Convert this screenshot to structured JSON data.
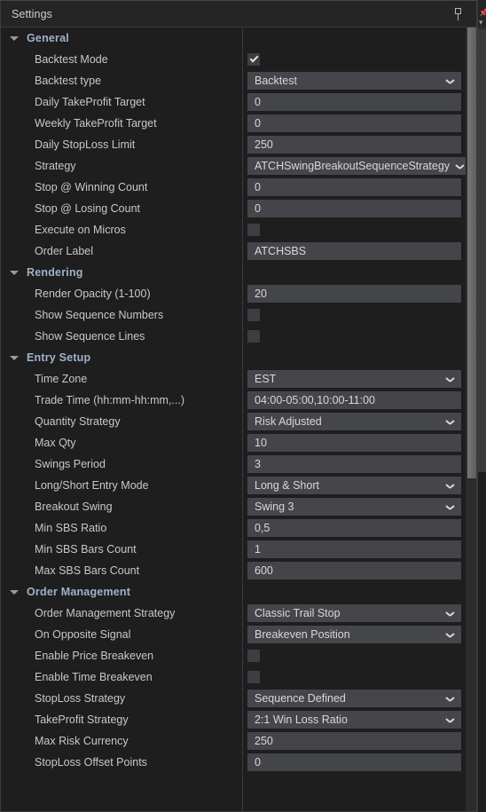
{
  "window": {
    "title": "Settings",
    "pin_icon": "pin-icon"
  },
  "neighbor": {
    "pin_icon": "pin-icon",
    "collapse_icon": "chevron-down-icon"
  },
  "sections": [
    {
      "label": "General",
      "rows": [
        {
          "label": "Backtest Mode",
          "type": "checkbox",
          "value": "checked"
        },
        {
          "label": "Backtest type",
          "type": "select",
          "value": "Backtest"
        },
        {
          "label": "Daily TakeProfit Target",
          "type": "text",
          "value": "0"
        },
        {
          "label": "Weekly TakeProfit Target",
          "type": "text",
          "value": "0"
        },
        {
          "label": "Daily StopLoss Limit",
          "type": "text",
          "value": "250"
        },
        {
          "label": "Strategy",
          "type": "select",
          "value": "ATCHSwingBreakoutSequenceStrategy"
        },
        {
          "label": "Stop @ Winning Count",
          "type": "text",
          "value": "0"
        },
        {
          "label": "Stop @ Losing Count",
          "type": "text",
          "value": "0"
        },
        {
          "label": "Execute on Micros",
          "type": "checkbox",
          "value": "unchecked"
        },
        {
          "label": "Order Label",
          "type": "text",
          "value": "ATCHSBS"
        }
      ]
    },
    {
      "label": "Rendering",
      "rows": [
        {
          "label": "Render Opacity (1-100)",
          "type": "text",
          "value": "20"
        },
        {
          "label": "Show Sequence Numbers",
          "type": "checkbox",
          "value": "unchecked"
        },
        {
          "label": "Show Sequence Lines",
          "type": "checkbox",
          "value": "unchecked"
        }
      ]
    },
    {
      "label": "Entry Setup",
      "rows": [
        {
          "label": "Time Zone",
          "type": "select",
          "value": "EST"
        },
        {
          "label": "Trade Time (hh:mm-hh:mm,...)",
          "type": "text",
          "value": "04:00-05:00,10:00-11:00"
        },
        {
          "label": "Quantity Strategy",
          "type": "select",
          "value": "Risk Adjusted"
        },
        {
          "label": "Max Qty",
          "type": "text",
          "value": "10"
        },
        {
          "label": "Swings Period",
          "type": "text",
          "value": "3"
        },
        {
          "label": "Long/Short Entry Mode",
          "type": "select",
          "value": "Long & Short"
        },
        {
          "label": "Breakout Swing",
          "type": "select",
          "value": "Swing 3"
        },
        {
          "label": "Min SBS Ratio",
          "type": "text",
          "value": "0,5"
        },
        {
          "label": "Min SBS Bars Count",
          "type": "text",
          "value": "1"
        },
        {
          "label": "Max SBS Bars Count",
          "type": "text",
          "value": "600"
        }
      ]
    },
    {
      "label": "Order Management",
      "rows": [
        {
          "label": "Order Management Strategy",
          "type": "select",
          "value": "Classic Trail Stop"
        },
        {
          "label": "On Opposite Signal",
          "type": "select",
          "value": "Breakeven Position"
        },
        {
          "label": "Enable Price Breakeven",
          "type": "checkbox",
          "value": "unchecked"
        },
        {
          "label": "Enable Time Breakeven",
          "type": "checkbox",
          "value": "unchecked"
        },
        {
          "label": "StopLoss Strategy",
          "type": "select",
          "value": "Sequence Defined"
        },
        {
          "label": "TakeProfit Strategy",
          "type": "select",
          "value": "2:1 Win Loss Ratio"
        },
        {
          "label": "Max Risk Currency",
          "type": "text",
          "value": "250"
        },
        {
          "label": "StopLoss Offset Points",
          "type": "text",
          "value": "0"
        }
      ]
    }
  ],
  "scrollbar": {
    "thumb_top": 0,
    "thumb_height": 508
  },
  "colors": {
    "panel_bg": "#1e1e1e",
    "titlebar_bg": "#252525",
    "field_bg": "#44454a",
    "section_text": "#9fb2c8",
    "label_text": "#c8c8c8",
    "value_text": "#d8d8d8"
  }
}
